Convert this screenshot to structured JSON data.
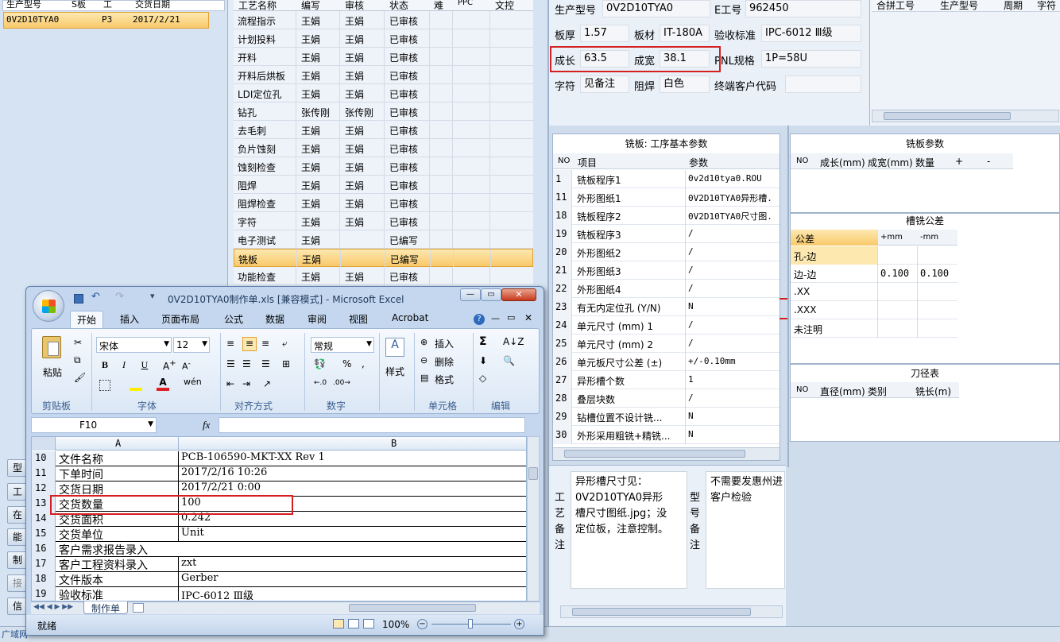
{
  "left_list": {
    "headers": [
      "生产型号",
      "S板",
      "工",
      "交货日期"
    ],
    "row": {
      "model": "0V2D10TYA0",
      "s": "P3",
      "date": "2017/2/21"
    }
  },
  "side_buttons": [
    "型",
    "工",
    "在",
    "能",
    "制作",
    "接料",
    "信"
  ],
  "bottom_bar": {
    "text": "广域网"
  },
  "process": {
    "headers": [
      "工艺名称",
      "编写",
      "审核",
      "状态",
      "难",
      "PPC",
      "文控"
    ],
    "rows": [
      [
        "流程指示",
        "王娟",
        "王娟",
        "已审核"
      ],
      [
        "计划投料",
        "王娟",
        "王娟",
        "已审核"
      ],
      [
        "开料",
        "王娟",
        "王娟",
        "已审核"
      ],
      [
        "开料后烘板",
        "王娟",
        "王娟",
        "已审核"
      ],
      [
        "LDI定位孔",
        "王娟",
        "王娟",
        "已审核"
      ],
      [
        "钻孔",
        "张传刚",
        "张传刚",
        "已审核"
      ],
      [
        "去毛刺",
        "王娟",
        "王娟",
        "已审核"
      ],
      [
        "负片蚀刻",
        "王娟",
        "王娟",
        "已审核"
      ],
      [
        "蚀刻检查",
        "王娟",
        "王娟",
        "已审核"
      ],
      [
        "阻焊",
        "王娟",
        "王娟",
        "已审核"
      ],
      [
        "阻焊检查",
        "王娟",
        "王娟",
        "已审核"
      ],
      [
        "字符",
        "王娟",
        "王娟",
        "已审核"
      ],
      [
        "电子测试",
        "王娟",
        "",
        "已编写"
      ],
      [
        "铣板",
        "王娟",
        "",
        "已编写"
      ],
      [
        "功能检查",
        "王娟",
        "王娟",
        "已审核"
      ]
    ]
  },
  "info": {
    "model_label": "生产型号",
    "model": "0V2D10TYA0",
    "eno_label": "E工号",
    "eno": "962450",
    "thick_label": "板厚",
    "thick": "1.57",
    "mat_label": "板材",
    "mat": "IT-180A",
    "std_label": "验收标准",
    "std": "IPC-6012 Ⅲ级",
    "len_label": "成长",
    "len": "63.5",
    "wid_label": "成宽",
    "wid": "38.1",
    "pnl_label": "PNL规格",
    "pnl": "1P=58U",
    "char_label": "字符",
    "char": "见备注",
    "mask_label": "阻焊",
    "mask": "白色",
    "cust_label": "终端客户代码",
    "cust": ""
  },
  "merge": {
    "headers": [
      "合拼工号",
      "生产型号",
      "周期",
      "字符"
    ]
  },
  "params": {
    "title": "铣板: 工序基本参数",
    "headers": [
      "NO",
      "项目",
      "参数"
    ],
    "rows": [
      [
        "1",
        "铣板程序1",
        "0v2d10tya0.ROU"
      ],
      [
        "11",
        "外形图纸1",
        "0V2D10TYA0异形槽."
      ],
      [
        "18",
        "铣板程序2",
        "0V2D10TYA0尺寸图."
      ],
      [
        "19",
        "铣板程序3",
        "/"
      ],
      [
        "20",
        "外形图纸2",
        "/"
      ],
      [
        "21",
        "外形图纸3",
        "/"
      ],
      [
        "22",
        "外形图纸4",
        "/"
      ],
      [
        "23",
        "有无内定位孔 (Y/N)",
        "N"
      ],
      [
        "24",
        "单元尺寸 (mm) 1",
        "/"
      ],
      [
        "25",
        "单元尺寸 (mm) 2",
        "/"
      ],
      [
        "26",
        "单元板尺寸公差 (±)",
        "+/-0.10mm"
      ],
      [
        "27",
        "异形槽个数",
        "1"
      ],
      [
        "28",
        "叠层块数",
        "/"
      ],
      [
        "29",
        "钻槽位置不设计铣...",
        "N"
      ],
      [
        "30",
        "外形采用粗铣+精铣...",
        "N"
      ]
    ]
  },
  "mill_params": {
    "title": "铣板参数",
    "headers": [
      "NO",
      "成长(mm)",
      "成宽(mm)",
      "数量",
      "+",
      "-"
    ]
  },
  "slot_tol": {
    "title": "槽铣公差",
    "headers": [
      "公差",
      "+mm",
      "-mm"
    ],
    "rows": [
      [
        "孔-边",
        "",
        ""
      ],
      [
        "边-边",
        "0.100",
        "0.100"
      ],
      [
        ".XX",
        "",
        ""
      ],
      [
        ".XXX",
        "",
        ""
      ],
      [
        "未注明",
        "",
        ""
      ]
    ]
  },
  "tool_table": {
    "title": "刀径表",
    "headers": [
      "NO",
      "直径(mm)",
      "类别",
      "铣长(m)"
    ]
  },
  "remarks": {
    "proc_label": "工艺备注",
    "proc_text": "异形槽尺寸见：0V2D10TYA0异形槽尺寸图纸.jpg；没定位板，注意控制。",
    "model_label": "型号备注",
    "model_text": "不需要发惠州进客户检验"
  },
  "excel": {
    "title": "0V2D10TYA0制作单.xls  [兼容模式] - Microsoft Excel",
    "tabs": [
      "开始",
      "插入",
      "页面布局",
      "公式",
      "数据",
      "审阅",
      "视图",
      "Acrobat"
    ],
    "font_name": "宋体",
    "font_size": "12",
    "number_format": "常规",
    "groups": [
      "剪贴板",
      "字体",
      "对齐方式",
      "数字",
      "单元格",
      "编辑"
    ],
    "paste": "粘贴",
    "styles": "样式",
    "insert": "插入",
    "delete": "删除",
    "format": "格式",
    "namebox": "F10",
    "fx": "fx",
    "col_a": "A",
    "col_b": "B",
    "rows": [
      [
        "10",
        "文件名称",
        "PCB-106590-MKT-XX Rev 1"
      ],
      [
        "11",
        "下单时间",
        "2017/2/16 10:26"
      ],
      [
        "12",
        "交货日期",
        "2017/2/21 0:00"
      ],
      [
        "13",
        "交货数量",
        "100"
      ],
      [
        "14",
        "交货面积",
        "0.242"
      ],
      [
        "15",
        "交货单位",
        "Unit"
      ],
      [
        "16",
        "客户需求报告录入",
        ""
      ],
      [
        "17",
        "客户工程资料录入",
        "zxt"
      ],
      [
        "18",
        "文件版本",
        "Gerber"
      ],
      [
        "19",
        "验收标准",
        "IPC-6012 Ⅲ级"
      ]
    ],
    "sheet_tab": "制作单",
    "status": "就绪",
    "zoom": "100%"
  }
}
